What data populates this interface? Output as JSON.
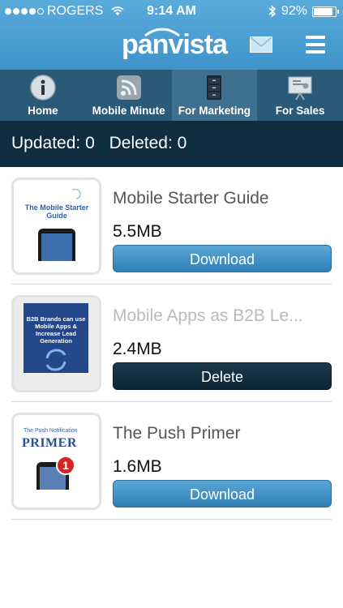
{
  "status_bar": {
    "carrier": "ROGERS",
    "time": "9:14 AM",
    "battery": "92%",
    "battery_level": 0.92,
    "signal_bars": 4
  },
  "header": {
    "logo": "panvista",
    "icons": [
      "mail-icon",
      "menu-icon"
    ],
    "accent_color": "#4a9fd5"
  },
  "tabs": [
    {
      "label": "Home",
      "icon": "info-icon",
      "active": false
    },
    {
      "label": "Mobile Minute",
      "icon": "rss-icon",
      "active": false
    },
    {
      "label": "For Marketing",
      "icon": "cabinet-icon",
      "active": true
    },
    {
      "label": "For Sales",
      "icon": "presentation-icon",
      "active": false
    }
  ],
  "summary": {
    "updated": "Updated: 0",
    "deleted": "Deleted: 0"
  },
  "items": [
    {
      "title": "Mobile Starter Guide",
      "size": "5.5MB",
      "button": "Download",
      "cover_text": "The Mobile Starter Guide"
    },
    {
      "title": "Mobile Apps as B2B Le...",
      "size": "2.4MB",
      "button": "Delete",
      "cover_text": "B2B Brands can use Mobile Apps & Increase Lead Generation"
    },
    {
      "title": "The Push Primer",
      "size": "1.6MB",
      "button": "Download",
      "cover_text_top": "The Push Notification",
      "cover_text_main": "PRIMER",
      "cover_badge": "1"
    }
  ]
}
